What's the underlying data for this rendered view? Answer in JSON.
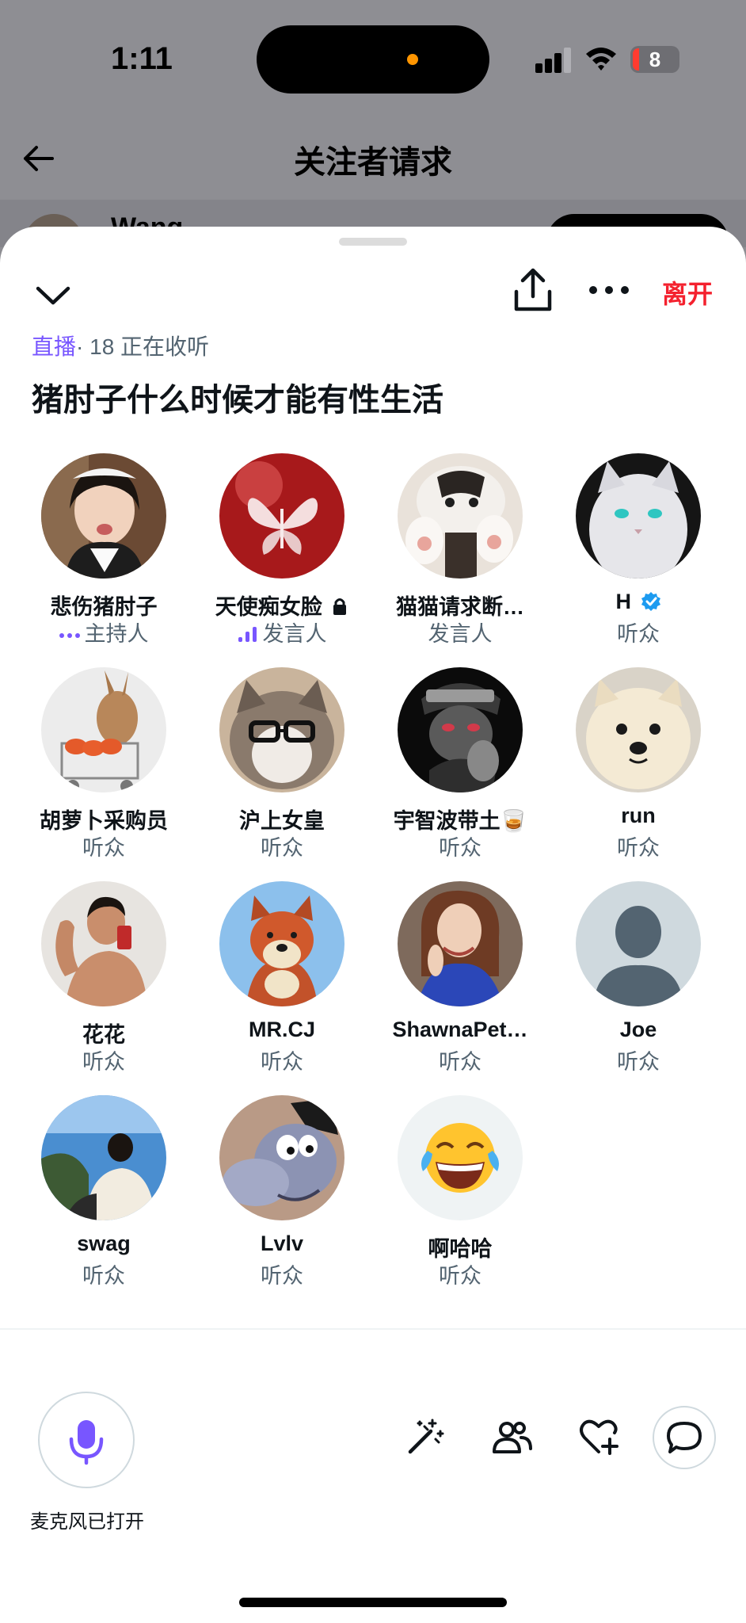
{
  "status": {
    "time": "1:11",
    "battery": "8"
  },
  "background": {
    "title": "关注者请求",
    "peek_name": "Wang"
  },
  "space": {
    "leave_label": "离开",
    "live_label": "直播",
    "listening": "· 18 正在收听",
    "title": "猪肘子什么时候才能有性生活"
  },
  "participants": [
    {
      "name": "悲伤猪肘子",
      "role": "主持人",
      "avatar": "maid-girl"
    },
    {
      "name": "天使痴女脸",
      "role": "发言人",
      "avatar": "red-butterfly"
    },
    {
      "name": "猫猫请求断…",
      "role": "发言人",
      "avatar": "cat-paws"
    },
    {
      "name": "H",
      "role": "听众",
      "avatar": "white-cat"
    },
    {
      "name": "胡萝卜采购员",
      "role": "听众",
      "avatar": "rabbit-cart"
    },
    {
      "name": "沪上女皇",
      "role": "听众",
      "avatar": "cat-glasses"
    },
    {
      "name": "宇智波带土🥃",
      "role": "听众",
      "avatar": "dark-ninja"
    },
    {
      "name": "run",
      "role": "听众",
      "avatar": "samoyed"
    },
    {
      "name": "花花",
      "role": "听众",
      "avatar": "mirror-selfie"
    },
    {
      "name": "MR.CJ",
      "role": "听众",
      "avatar": "fox-plush"
    },
    {
      "name": "ShawnaPet…",
      "role": "听众",
      "avatar": "woman-portrait"
    },
    {
      "name": "Joe",
      "role": "听众",
      "avatar": "default-person"
    },
    {
      "name": "swag",
      "role": "听众",
      "avatar": "sea-view"
    },
    {
      "name": "Lvlv",
      "role": "听众",
      "avatar": "eeyore"
    },
    {
      "name": "啊哈哈",
      "role": "听众",
      "avatar": "laughing-emoji"
    }
  ],
  "footer": {
    "mic_label": "麦克风已打开"
  },
  "colors": {
    "accent": "#7856ff",
    "leave": "#f4212e",
    "verified": "#1d9bf0",
    "secondary_text": "#536471"
  }
}
